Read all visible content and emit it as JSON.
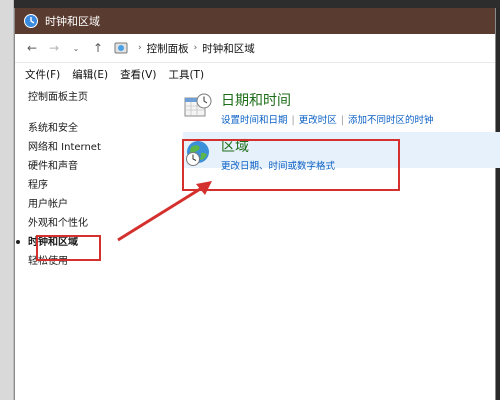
{
  "window": {
    "title": "时钟和区域"
  },
  "address": {
    "breadcrumbs": [
      "控制面板",
      "时钟和区域"
    ]
  },
  "menu": {
    "items": [
      "文件(F)",
      "编辑(E)",
      "查看(V)",
      "工具(T)"
    ]
  },
  "sidebar": {
    "home": "控制面板主页",
    "items": [
      "系统和安全",
      "网络和 Internet",
      "硬件和声音",
      "程序",
      "用户帐户",
      "外观和个性化",
      "时钟和区域",
      "轻松使用"
    ],
    "active_index": 6
  },
  "categories": [
    {
      "title": "日期和时间",
      "links": [
        "设置时间和日期",
        "更改时区",
        "添加不同时区的时钟"
      ]
    },
    {
      "title": "区域",
      "links": [
        "更改日期、时间或数字格式"
      ]
    }
  ],
  "colors": {
    "accent": "#d4302d",
    "link": "#0b60c5",
    "category_title": "#1c6d17",
    "titlebar": "#5a3b30"
  }
}
